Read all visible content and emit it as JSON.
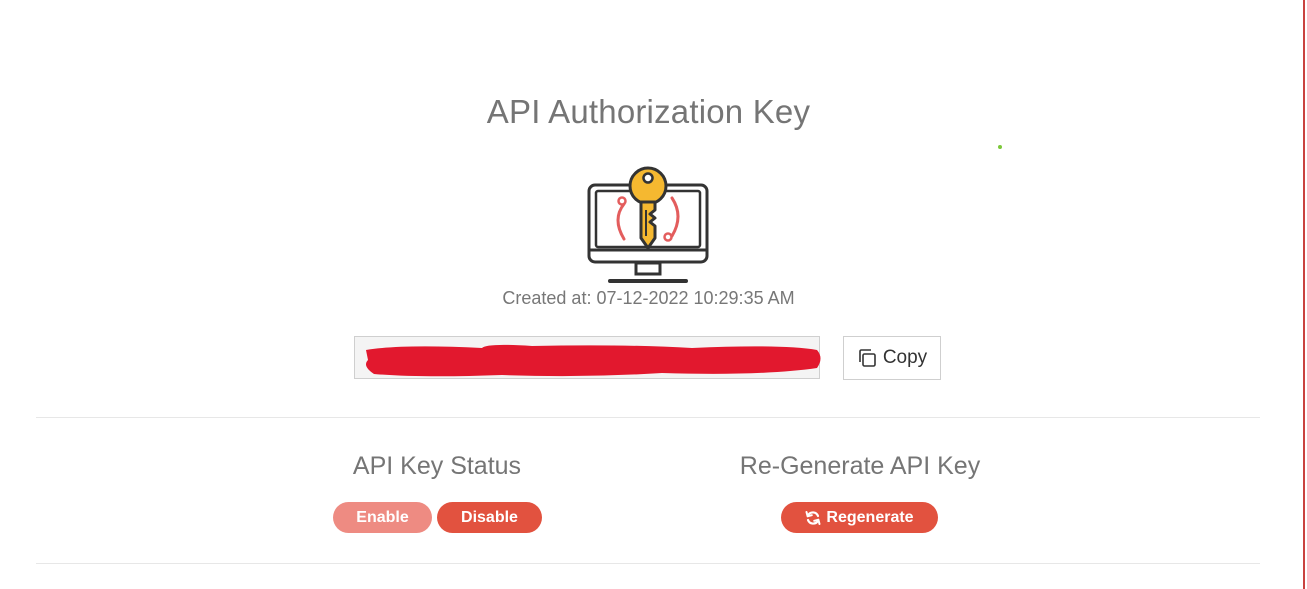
{
  "page": {
    "title": "API Authorization Key",
    "created_at": "Created at: 07-12-2022 10:29:35 AM"
  },
  "key_field": {
    "value": "",
    "redacted": true,
    "redaction_color": "#e2182e"
  },
  "copy_button": {
    "label": "Copy",
    "icon": "copy-icon"
  },
  "status_section": {
    "title": "API Key Status",
    "enable_label": "Enable",
    "disable_label": "Disable"
  },
  "regenerate_section": {
    "title": "Re-Generate API Key",
    "button_label": "Regenerate",
    "icon": "refresh-icon"
  },
  "colors": {
    "accent": "#e2523f",
    "accent_light": "#ee8b82",
    "heading": "#757575",
    "key_gold": "#f5b830",
    "key_outline": "#333333",
    "arc_red": "#e35d5d"
  }
}
